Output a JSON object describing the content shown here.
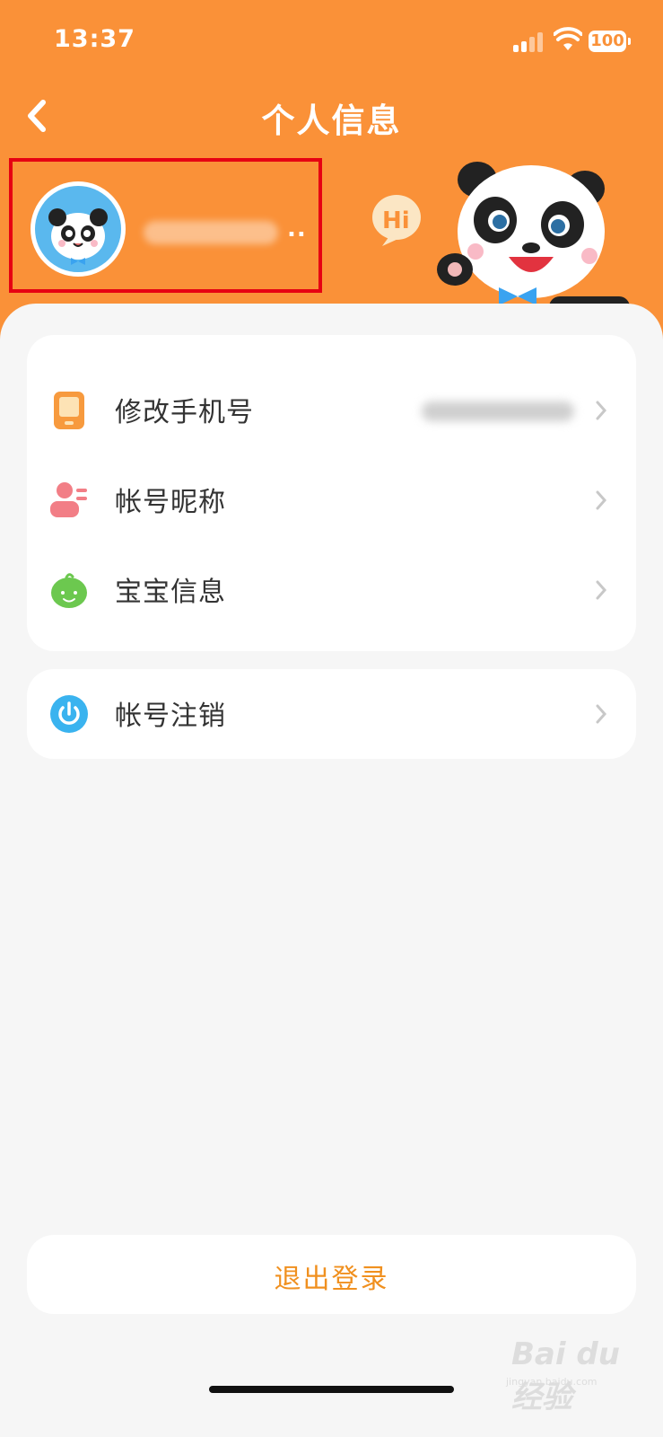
{
  "status_bar": {
    "time": "13:37",
    "battery": "100"
  },
  "nav": {
    "title": "个人信息"
  },
  "profile": {
    "nickname_suffix": ".."
  },
  "mascot": {
    "bubble_text": "Hi"
  },
  "menu_items": [
    {
      "label": "修改手机号",
      "icon": "phone-icon"
    },
    {
      "label": "帐号昵称",
      "icon": "user-nickname-icon"
    },
    {
      "label": "宝宝信息",
      "icon": "baby-icon"
    }
  ],
  "cancel_item": {
    "label": "帐号注销",
    "icon": "power-icon"
  },
  "logout": {
    "label": "退出登录"
  },
  "watermark": {
    "brand": "Bai du 经验",
    "url": "jingyan.baidu.com"
  },
  "colors": {
    "header": "#fa9138",
    "highlight_border": "#e60012",
    "logout_text": "#f0901f",
    "background": "#f6f6f6"
  }
}
